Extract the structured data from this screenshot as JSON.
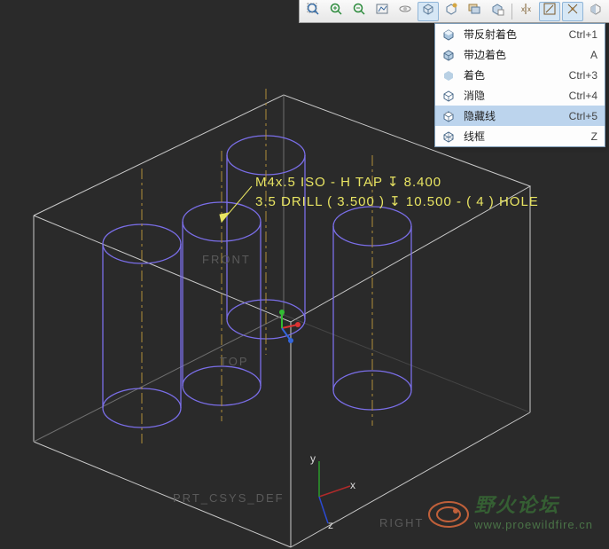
{
  "toolbar": {
    "buttons": [
      {
        "name": "zoom-fit-icon"
      },
      {
        "name": "zoom-in-icon"
      },
      {
        "name": "zoom-out-icon"
      },
      {
        "name": "repaint-icon"
      },
      {
        "name": "spin-icon"
      },
      {
        "name": "display-style-icon",
        "active": true
      },
      {
        "name": "saved-views-icon"
      },
      {
        "name": "layers-icon"
      },
      {
        "name": "view-manager-icon"
      },
      {
        "name": "sep"
      },
      {
        "name": "datum-plane-icon"
      },
      {
        "name": "datum-axis-icon",
        "active": true
      },
      {
        "name": "datum-point-icon",
        "active": true
      },
      {
        "name": "half-icon"
      }
    ]
  },
  "menu": {
    "items": [
      {
        "label": "带反射着色",
        "shortcut": "Ctrl+1",
        "icon": "cube-shaded-reflect"
      },
      {
        "label": "带边着色",
        "shortcut": "A",
        "icon": "cube-shaded-edge"
      },
      {
        "label": "着色",
        "shortcut": "Ctrl+3",
        "icon": "cube-shaded"
      },
      {
        "label": "消隐",
        "shortcut": "Ctrl+4",
        "icon": "cube-hidden"
      },
      {
        "label": "隐藏线",
        "shortcut": "Ctrl+5",
        "icon": "cube-hidden-line",
        "highlight": true
      },
      {
        "label": "线框",
        "shortcut": "Z",
        "icon": "cube-wireframe"
      }
    ]
  },
  "annotations": {
    "line1": "M4x.5 ISO - H TAP ↧ 8.400",
    "line2": "3.5 DRILL ( 3.500 ) ↧ 10.500 - ( 4 ) HOLE"
  },
  "datum_labels": {
    "front": "FRONT",
    "top": "TOP",
    "right": "RIGHT",
    "csys": "PRT_CSYS_DEF"
  },
  "axes": {
    "x": "x",
    "y": "y",
    "z": "z"
  },
  "watermark": {
    "brand": "野火论坛",
    "url": "www.proewildfire.cn"
  }
}
